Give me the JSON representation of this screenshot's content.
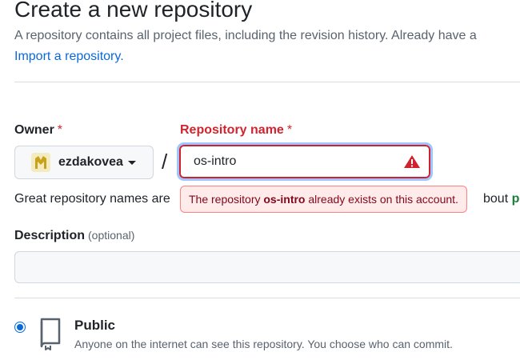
{
  "page": {
    "title": "Create a new repository",
    "intro": "A repository contains all project files, including the revision history. Already have a",
    "import_link": "Import a repository."
  },
  "owner": {
    "label": "Owner",
    "required_mark": "*",
    "name": "ezdakovea",
    "avatar_icon": "owner-avatar"
  },
  "separator": "/",
  "repo_name": {
    "label": "Repository name",
    "required_mark": "*",
    "value": "os-intro",
    "warning_icon": "alert-triangle-icon",
    "error_prefix": "The repository",
    "error_name": "os-intro",
    "error_suffix": "already exists on this account."
  },
  "hint": {
    "prefix": "Great repository names are",
    "tail_text": "bout",
    "tail_green": "ps"
  },
  "description": {
    "label": "Description",
    "optional": "(optional)",
    "value": ""
  },
  "visibility": {
    "selected": "public",
    "public_title": "Public",
    "public_desc": "Anyone on the internet can see this repository. You choose who can commit.",
    "public_icon": "repo-icon"
  },
  "colors": {
    "error": "#d1242f",
    "link": "#0969da",
    "focus_ring": "#9ec5fe",
    "error_bg": "#ffebe9"
  }
}
